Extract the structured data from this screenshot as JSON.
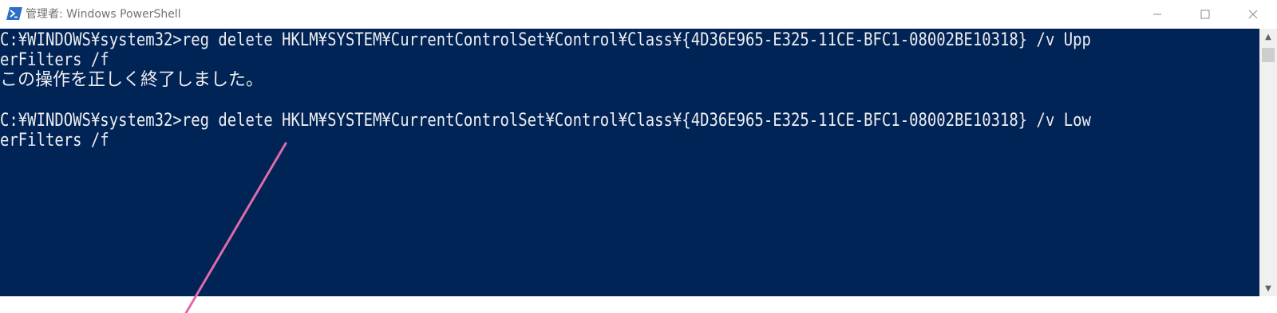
{
  "window": {
    "title": "管理者: Windows PowerShell",
    "icon": "powershell-icon",
    "controls": {
      "minimize_icon": "minimize-icon",
      "maximize_icon": "maximize-icon",
      "close_icon": "close-icon"
    }
  },
  "console": {
    "background": "#012456",
    "foreground": "#eeedf0",
    "lines": [
      "C:¥WINDOWS¥system32>reg delete HKLM¥SYSTEM¥CurrentControlSet¥Control¥Class¥{4D36E965-E325-11CE-BFC1-08002BE10318} /v Upp",
      "erFilters /f",
      "この操作を正しく終了しました。",
      "C:¥WINDOWS¥system32>reg delete HKLM¥SYSTEM¥CurrentControlSet¥Control¥Class¥{4D36E965-E325-11CE-BFC1-08002BE10318} /v Low",
      "erFilters /f"
    ]
  },
  "scrollbar": {
    "up_arrow": "▲",
    "down_arrow": "▼"
  },
  "annotation": {
    "color": "#e06aa8"
  }
}
